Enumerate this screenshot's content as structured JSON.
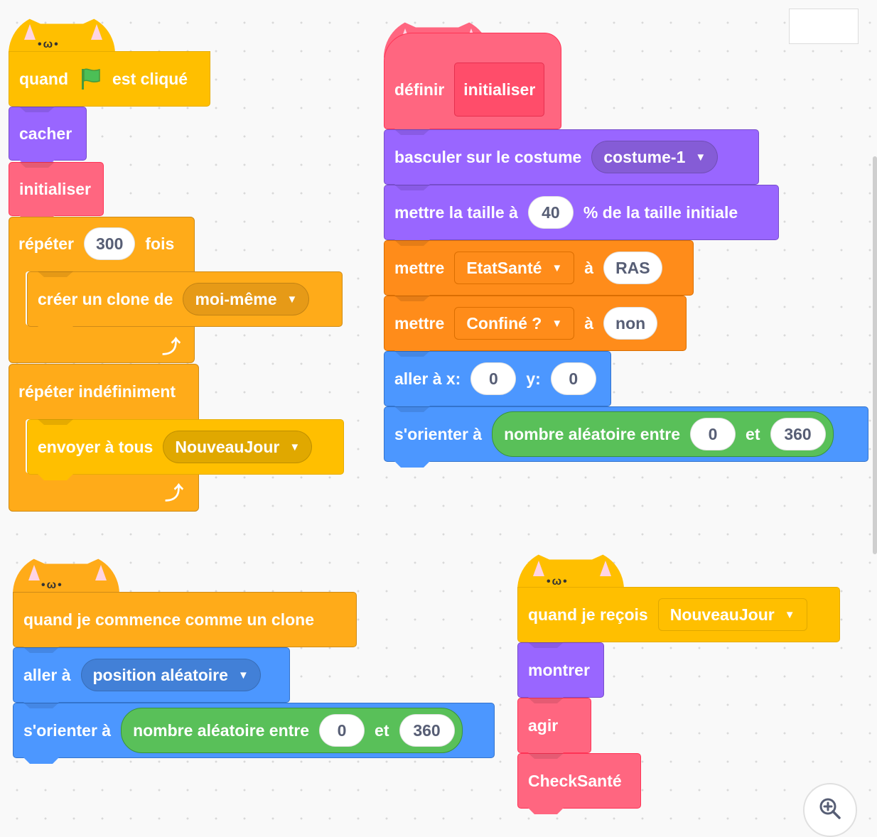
{
  "script1": {
    "hat_prefix": "quand",
    "hat_suffix": "est cliqué",
    "flag_icon": "green-flag-icon",
    "hide": "cacher",
    "call_init": "initialiser",
    "repeat_label": "répéter",
    "repeat_count": "300",
    "repeat_suffix": "fois",
    "create_clone": "créer un clone de",
    "clone_target": "moi-même",
    "forever": "répéter indéfiniment",
    "broadcast": "envoyer à tous",
    "broadcast_msg": "NouveauJour"
  },
  "script2": {
    "define": "définir",
    "proc_name": "initialiser",
    "switch_costume": "basculer sur le costume",
    "costume": "costume-1",
    "set_size": "mettre la taille à",
    "size_value": "40",
    "size_suffix": "% de la taille initiale",
    "set1": "mettre",
    "var1": "EtatSanté",
    "to1": "à",
    "val1": "RAS",
    "set2": "mettre",
    "var2": "Confiné ?",
    "to2": "à",
    "val2": "non",
    "goto_xy": "aller à x:",
    "x_val": "0",
    "y_label": "y:",
    "y_val": "0",
    "point_dir": "s'orienter à",
    "random_label": "nombre aléatoire entre",
    "rand_from": "0",
    "and_label": "et",
    "rand_to": "360"
  },
  "script3": {
    "clone_hat": "quand je commence comme un clone",
    "goto": "aller à",
    "goto_target": "position aléatoire",
    "point_dir": "s'orienter à",
    "random_label": "nombre aléatoire entre",
    "rand_from": "0",
    "and_label": "et",
    "rand_to": "360"
  },
  "script4": {
    "receive": "quand je reçois",
    "receive_msg": "NouveauJour",
    "show": "montrer",
    "act": "agir",
    "check": "CheckSanté"
  },
  "colors": {
    "events": "#ffbf00",
    "control": "#ffab19",
    "looks": "#9966ff",
    "motion": "#4c97ff",
    "variables": "#ff8c1a",
    "my_blocks": "#ff6680",
    "operators": "#59c059"
  },
  "zoom_icon": "zoom-in-icon"
}
